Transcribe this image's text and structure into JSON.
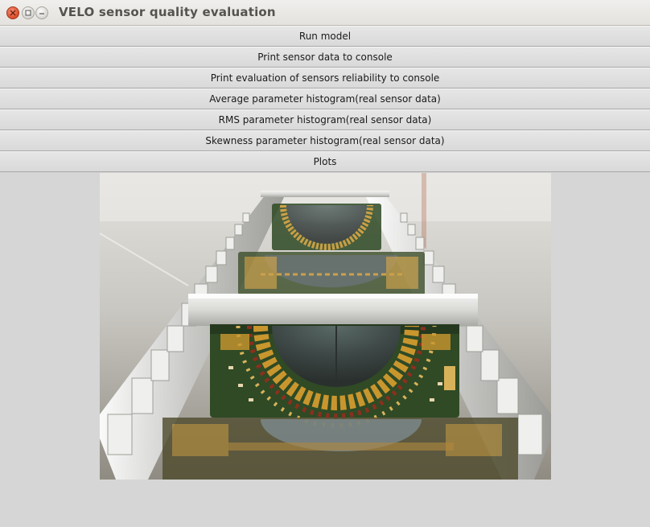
{
  "window": {
    "title": "VELO sensor quality evaluation",
    "controls": {
      "close_icon": "close-icon",
      "maximize_icon": "maximize-icon",
      "minimize_icon": "minimize-icon"
    }
  },
  "actions": [
    {
      "label": "Run model"
    },
    {
      "label": "Print sensor data to console"
    },
    {
      "label": "Print evaluation of sensors reliability to console"
    },
    {
      "label": "Average parameter histogram(real sensor data)"
    },
    {
      "label": "RMS parameter histogram(real sensor data)"
    },
    {
      "label": "Skewness parameter histogram(real sensor data)"
    },
    {
      "label": "Plots"
    }
  ],
  "image": {
    "subject": "VELO detector modules mounted in aluminium frame"
  },
  "colors": {
    "background": "#d6d6d6",
    "title_text": "#55534e",
    "close_button": "#e0542f",
    "pcb_green": "#2f4a25",
    "gold_pads": "#c9962e"
  }
}
